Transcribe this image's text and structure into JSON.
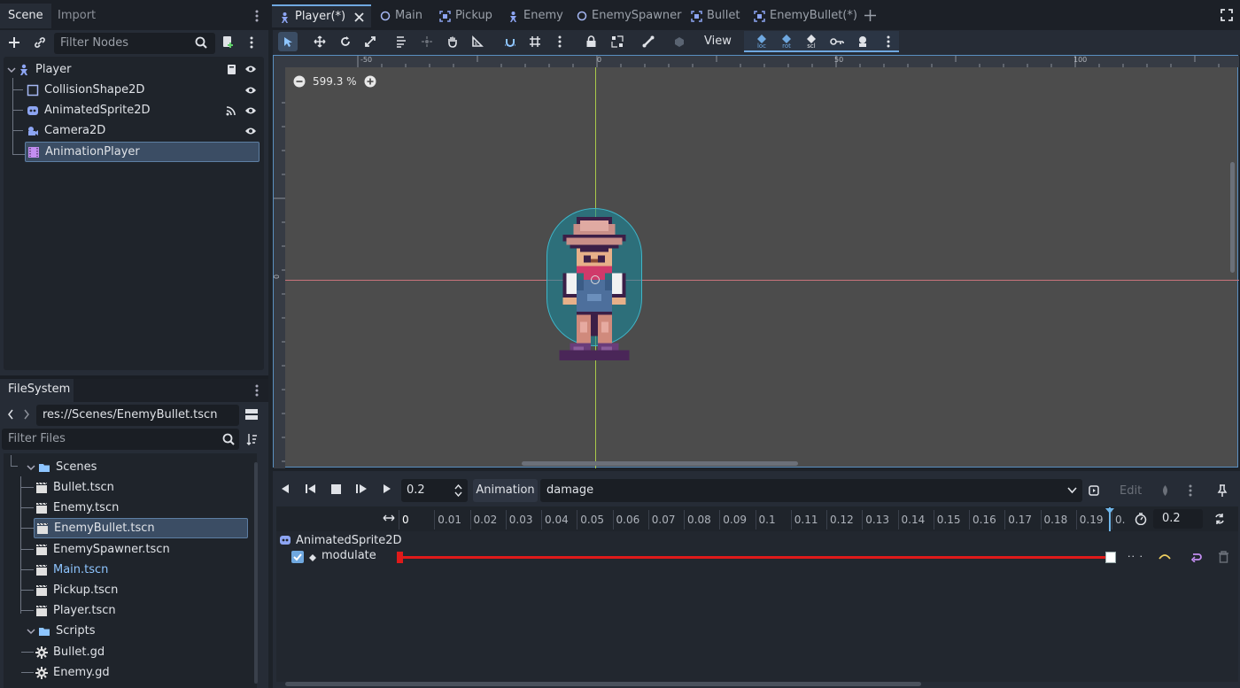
{
  "scene_dock": {
    "tabs": [
      "Scene",
      "Import"
    ],
    "filter_placeholder": "Filter Nodes",
    "nodes": [
      {
        "label": "Player",
        "icon": "player-node-icon"
      },
      {
        "label": "CollisionShape2D",
        "icon": "collision-shape-icon"
      },
      {
        "label": "AnimatedSprite2D",
        "icon": "animated-sprite-icon"
      },
      {
        "label": "Camera2D",
        "icon": "camera-icon"
      },
      {
        "label": "AnimationPlayer",
        "icon": "animation-player-icon"
      }
    ]
  },
  "filesystem_dock": {
    "tab": "FileSystem",
    "path": "res://Scenes/EnemyBullet.tscn",
    "filter_placeholder": "Filter Files",
    "items": [
      {
        "label": "Scenes",
        "type": "folder"
      },
      {
        "label": "Bullet.tscn",
        "type": "scene"
      },
      {
        "label": "Enemy.tscn",
        "type": "scene"
      },
      {
        "label": "EnemyBullet.tscn",
        "type": "scene"
      },
      {
        "label": "EnemySpawner.tscn",
        "type": "scene"
      },
      {
        "label": "Main.tscn",
        "type": "scene"
      },
      {
        "label": "Pickup.tscn",
        "type": "scene"
      },
      {
        "label": "Player.tscn",
        "type": "scene"
      },
      {
        "label": "Scripts",
        "type": "folder"
      },
      {
        "label": "Bullet.gd",
        "type": "script"
      },
      {
        "label": "Enemy.gd",
        "type": "script"
      }
    ]
  },
  "scene_tabs": [
    "Player(*)",
    "Main",
    "Pickup",
    "Enemy",
    "EnemySpawner",
    "Bullet",
    "EnemyBullet(*)"
  ],
  "toolbar": {
    "view_label": "View",
    "keys": [
      "loc",
      "rot",
      "scl"
    ]
  },
  "viewport": {
    "zoom": "599.3 %",
    "ruler_labels": [
      "-50",
      "0",
      "50",
      "100"
    ],
    "side_ruler_label": "0"
  },
  "animation_panel": {
    "time_value": "0.2",
    "animation_button": "Animation",
    "current_animation": "damage",
    "edit_label": "Edit",
    "length_value": "0.2",
    "timeline_ticks": [
      "0",
      "0.01",
      "0.02",
      "0.03",
      "0.04",
      "0.05",
      "0.06",
      "0.07",
      "0.08",
      "0.09",
      "0.1",
      "0.11",
      "0.12",
      "0.13",
      "0.14",
      "0.15",
      "0.16",
      "0.17",
      "0.18",
      "0.19",
      "0."
    ],
    "track_node": "AnimatedSprite2D",
    "track_property": "modulate"
  },
  "colors": {
    "accent": "#6fa8e0",
    "track": "#e01a1a",
    "selection": "#3b4d64",
    "collision": "#2e8a96"
  }
}
